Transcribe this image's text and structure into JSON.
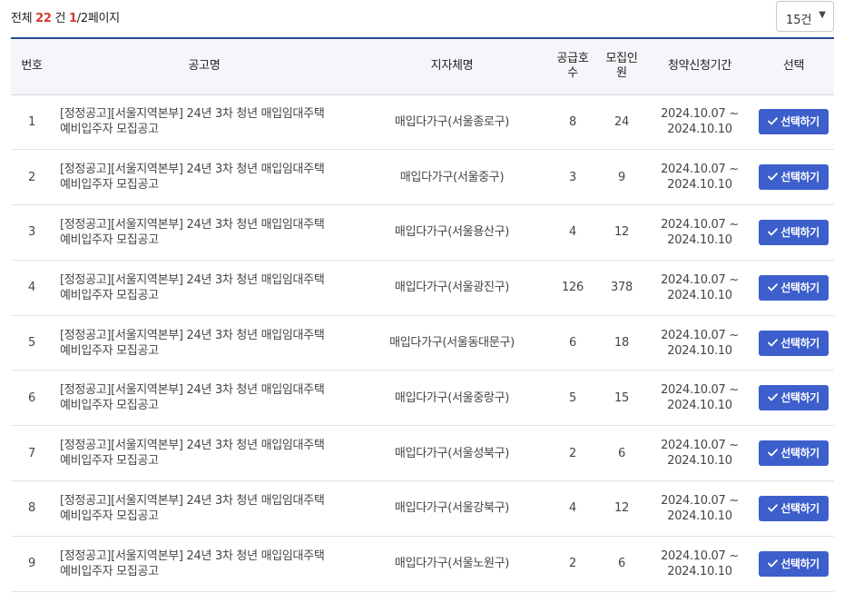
{
  "summary": {
    "prefix": "전체",
    "total": "22",
    "unit": "건",
    "current_page": "1",
    "page_rest": "/2페이지"
  },
  "page_size": {
    "selected": "15건",
    "caret": "▼"
  },
  "table": {
    "headers": {
      "no": "번호",
      "title": "공고명",
      "branch": "지자체명",
      "supply_line1": "공급호",
      "supply_line2": "수",
      "recruit_line1": "모집인",
      "recruit_line2": "원",
      "period": "청약신청기간",
      "select": "선택"
    },
    "rows": [
      {
        "no": "1",
        "title_line1": "[정정공고][서울지역본부] 24년 3차 청년 매입임대주택",
        "title_line2": "예비입주자 모집공고",
        "branch": "매입다가구(서울종로구)",
        "supply": "8",
        "recruit": "24",
        "period_start": "2024.10.07 ~",
        "period_end": "2024.10.10",
        "button": "선택하기"
      },
      {
        "no": "2",
        "title_line1": "[정정공고][서울지역본부] 24년 3차 청년 매입임대주택",
        "title_line2": "예비입주자 모집공고",
        "branch": "매입다가구(서울중구)",
        "supply": "3",
        "recruit": "9",
        "period_start": "2024.10.07 ~",
        "period_end": "2024.10.10",
        "button": "선택하기"
      },
      {
        "no": "3",
        "title_line1": "[정정공고][서울지역본부] 24년 3차 청년 매입임대주택",
        "title_line2": "예비입주자 모집공고",
        "branch": "매입다가구(서울용산구)",
        "supply": "4",
        "recruit": "12",
        "period_start": "2024.10.07 ~",
        "period_end": "2024.10.10",
        "button": "선택하기"
      },
      {
        "no": "4",
        "title_line1": "[정정공고][서울지역본부] 24년 3차 청년 매입임대주택",
        "title_line2": "예비입주자 모집공고",
        "branch": "매입다가구(서울광진구)",
        "supply": "126",
        "recruit": "378",
        "period_start": "2024.10.07 ~",
        "period_end": "2024.10.10",
        "button": "선택하기"
      },
      {
        "no": "5",
        "title_line1": "[정정공고][서울지역본부] 24년 3차 청년 매입임대주택",
        "title_line2": "예비입주자 모집공고",
        "branch": "매입다가구(서울동대문구)",
        "supply": "6",
        "recruit": "18",
        "period_start": "2024.10.07 ~",
        "period_end": "2024.10.10",
        "button": "선택하기"
      },
      {
        "no": "6",
        "title_line1": "[정정공고][서울지역본부] 24년 3차 청년 매입임대주택",
        "title_line2": "예비입주자 모집공고",
        "branch": "매입다가구(서울중랑구)",
        "supply": "5",
        "recruit": "15",
        "period_start": "2024.10.07 ~",
        "period_end": "2024.10.10",
        "button": "선택하기"
      },
      {
        "no": "7",
        "title_line1": "[정정공고][서울지역본부] 24년 3차 청년 매입임대주택",
        "title_line2": "예비입주자 모집공고",
        "branch": "매입다가구(서울성북구)",
        "supply": "2",
        "recruit": "6",
        "period_start": "2024.10.07 ~",
        "period_end": "2024.10.10",
        "button": "선택하기"
      },
      {
        "no": "8",
        "title_line1": "[정정공고][서울지역본부] 24년 3차 청년 매입임대주택",
        "title_line2": "예비입주자 모집공고",
        "branch": "매입다가구(서울강북구)",
        "supply": "4",
        "recruit": "12",
        "period_start": "2024.10.07 ~",
        "period_end": "2024.10.10",
        "button": "선택하기"
      },
      {
        "no": "9",
        "title_line1": "[정정공고][서울지역본부] 24년 3차 청년 매입임대주택",
        "title_line2": "예비입주자 모집공고",
        "branch": "매입다가구(서울노원구)",
        "supply": "2",
        "recruit": "6",
        "period_start": "2024.10.07 ~",
        "period_end": "2024.10.10",
        "button": "선택하기"
      }
    ]
  },
  "colors": {
    "accent": "#3d5fcb",
    "header_border": "#2b4a8b",
    "highlight": "#d93a35"
  }
}
